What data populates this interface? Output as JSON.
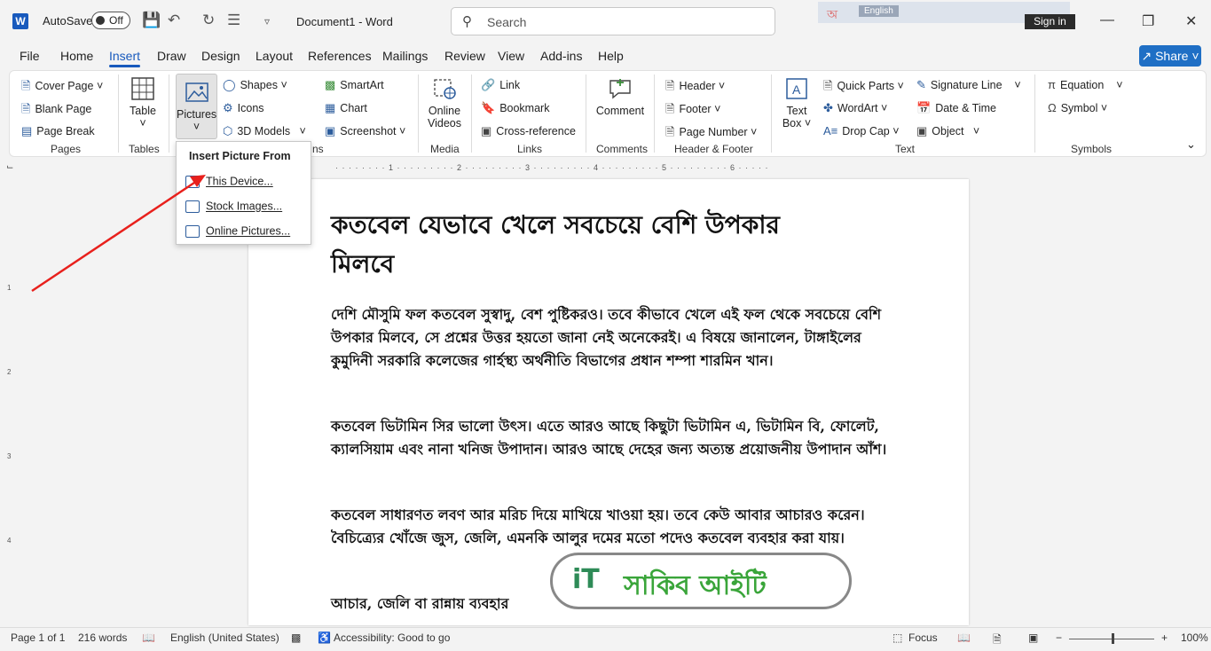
{
  "titlebar": {
    "autosave_label": "AutoSave",
    "autosave_state": "Off",
    "document_title": "Document1  -  Word",
    "search_placeholder": "Search",
    "ime_language": "English",
    "signin_label": "Sign in"
  },
  "menu": {
    "items": [
      "File",
      "Home",
      "Insert",
      "Draw",
      "Design",
      "Layout",
      "References",
      "Mailings",
      "Review",
      "View",
      "Add-ins",
      "Help"
    ],
    "active": "Insert",
    "share_label": "Share"
  },
  "ribbon": {
    "pages": {
      "cover_page": "Cover Page",
      "blank_page": "Blank Page",
      "page_break": "Page Break",
      "group": "Pages"
    },
    "tables": {
      "table": "Table",
      "group": "Tables"
    },
    "illustrations": {
      "pictures": "Pictures",
      "shapes": "Shapes",
      "icons": "Icons",
      "models": "3D Models",
      "smartart": "SmartArt",
      "chart": "Chart",
      "screenshot": "Screenshot",
      "group_suffix": "ns"
    },
    "media": {
      "online_videos_1": "Online",
      "online_videos_2": "Videos",
      "group": "Media"
    },
    "links": {
      "link": "Link",
      "bookmark": "Bookmark",
      "cross_reference": "Cross-reference",
      "group": "Links"
    },
    "comments": {
      "comment": "Comment",
      "group": "Comments"
    },
    "header_footer": {
      "header": "Header",
      "footer": "Footer",
      "page_number": "Page Number",
      "group": "Header & Footer"
    },
    "text": {
      "text_box_1": "Text",
      "text_box_2": "Box",
      "quick_parts": "Quick Parts",
      "wordart": "WordArt",
      "drop_cap": "Drop Cap",
      "signature_line": "Signature Line",
      "date_time": "Date & Time",
      "object": "Object",
      "group": "Text"
    },
    "symbols": {
      "equation": "Equation",
      "symbol": "Symbol",
      "group": "Symbols"
    }
  },
  "dropdown": {
    "title": "Insert Picture From",
    "items": [
      "This Device...",
      "Stock Images...",
      "Online Pictures..."
    ]
  },
  "ruler": {
    "h_numbers": [
      "1",
      "2",
      "3",
      "4",
      "5",
      "6"
    ],
    "v_numbers": [
      "1",
      "2",
      "3",
      "4"
    ]
  },
  "document": {
    "heading": "কতবেল যেভাবে খেলে সবচেয়ে বেশি উপকার মিলবে",
    "paragraphs": [
      "দেশি মৌসুমি ফল কতবেল সুস্বাদু, বেশ পুষ্টিকরও। তবে কীভাবে খেলে এই ফল থেকে সবচেয়ে বেশি উপকার মিলবে, সে প্রশ্নের উত্তর হয়তো জানা নেই অনেকেরই। এ বিষয়ে জানালেন, টাঙ্গাইলের কুমুদিনী সরকারি কলেজের গার্হস্থ্য অর্থনীতি বিভাগের প্রধান শম্পা শারমিন খান।",
      "কতবেল ভিটামিন সির ভালো উৎস। এতে আরও আছে কিছুটা ভিটামিন এ, ভিটামিন বি, ফোলেট, ক্যালসিয়াম এবং নানা খনিজ উপাদান। আরও আছে দেহের জন্য অত্যন্ত প্রয়োজনীয় উপাদান আঁশ।",
      "কতবেল সাধারণত লবণ আর মরিচ দিয়ে মাখিয়ে খাওয়া হয়। তবে কেউ আবার আচারও করেন। বৈচিত্র্যের খোঁজে জুস, জেলি, এমনকি আলুর দমের মতো পদেও কতবেল ব্যবহার করা যায়।",
      "আচার, জেলি বা রান্নায় ব্যবহার"
    ],
    "watermark_text": "সাকিব আইটি",
    "watermark_mark": "iT"
  },
  "statusbar": {
    "page": "Page 1 of 1",
    "words": "216 words",
    "language": "English (United States)",
    "accessibility": "Accessibility: Good to go",
    "focus": "Focus",
    "zoom": "100%"
  },
  "colors": {
    "accent": "#185abd",
    "share_bg": "#1f6fc5",
    "arrow": "#e8201c"
  }
}
